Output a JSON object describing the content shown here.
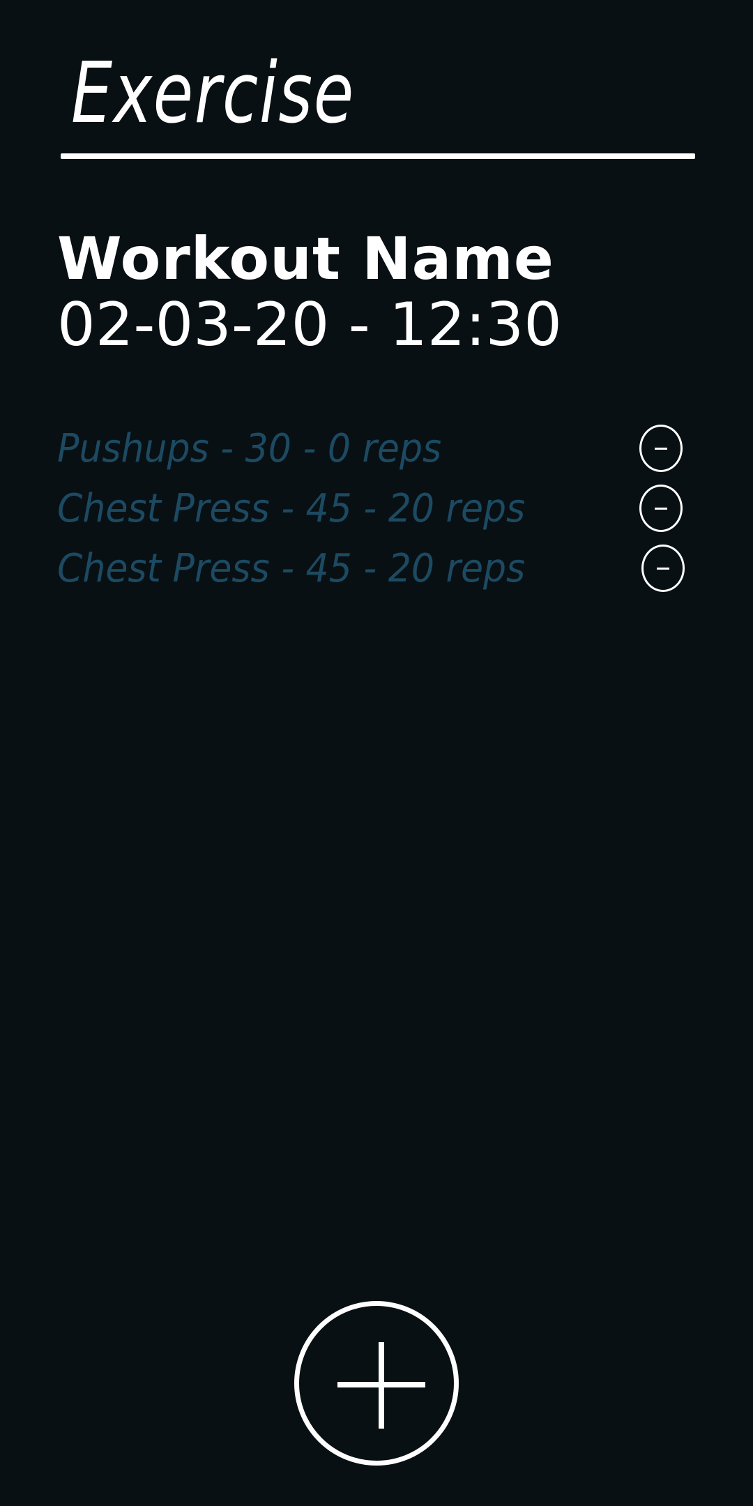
{
  "header": {
    "title": "Exercise"
  },
  "workout": {
    "name": "Workout Name",
    "datetime": "02-03-20 - 12:30"
  },
  "exercises": [
    {
      "label": "Pushups - 30 - 0 reps",
      "remove_label": "-"
    },
    {
      "label": "Chest Press - 45 - 20 reps",
      "remove_label": "-"
    },
    {
      "label": "Chest Press - 45 - 20 reps",
      "remove_label": "-"
    }
  ],
  "actions": {
    "add_icon": "plus-icon",
    "remove_icon": "minus-icon"
  },
  "colors": {
    "background": "#081013",
    "foreground": "#ffffff",
    "exercise_text": "#1c4a62"
  }
}
